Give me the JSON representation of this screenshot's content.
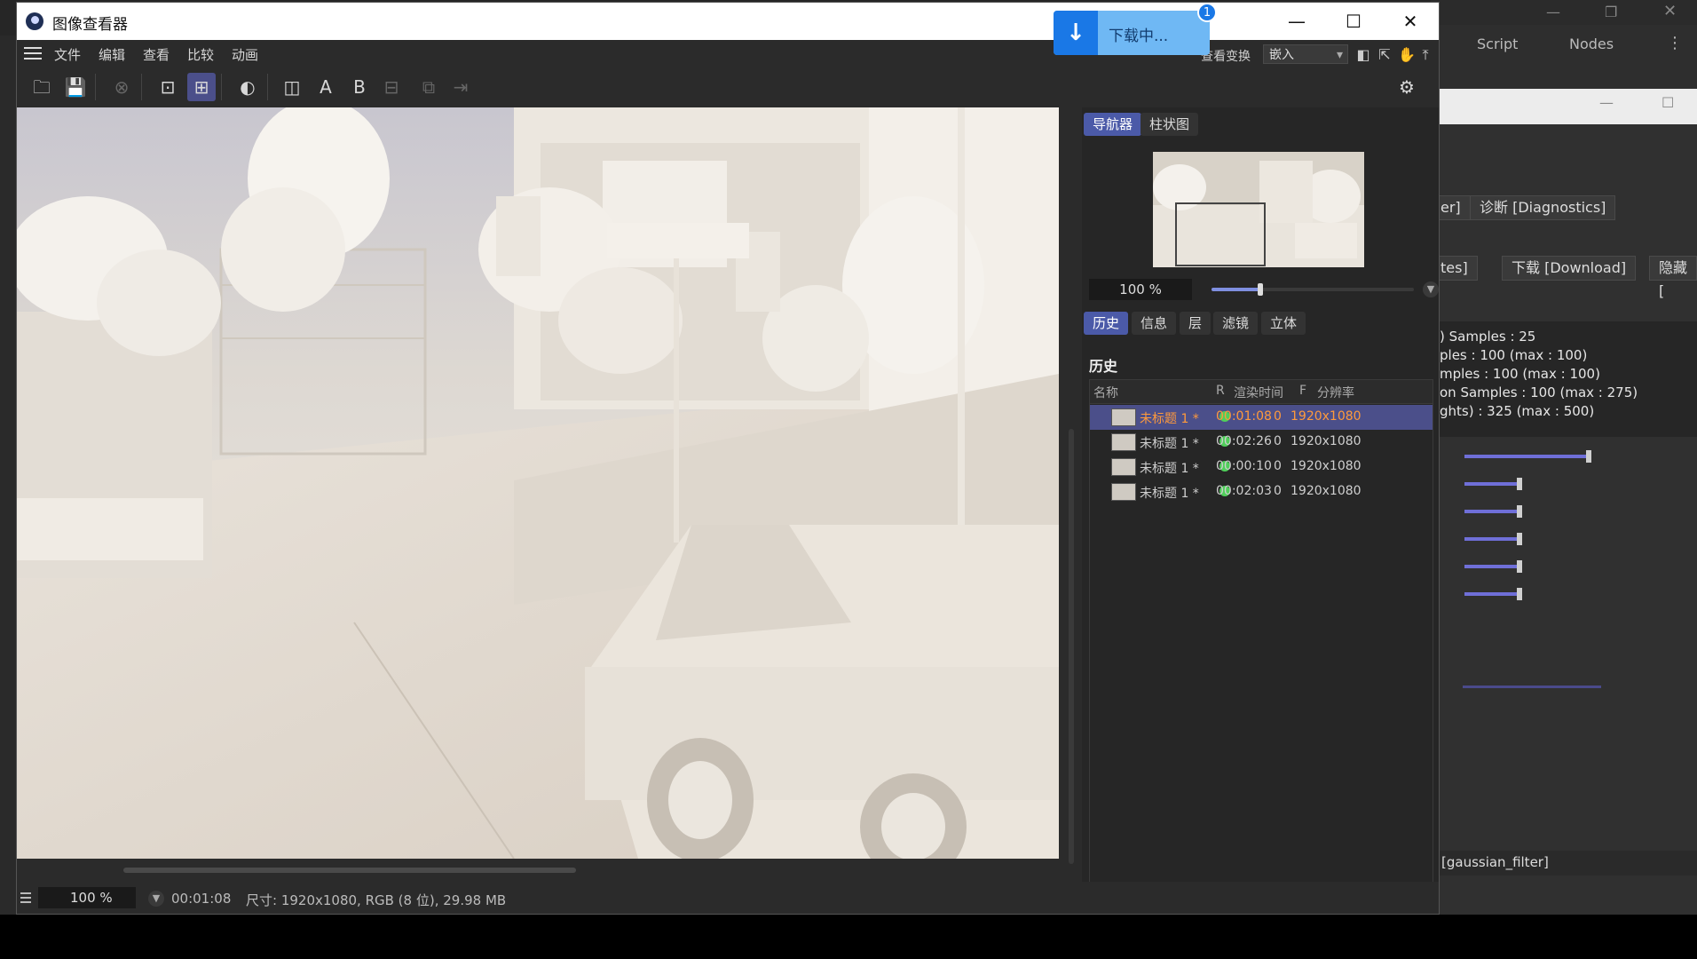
{
  "window": {
    "title": "图像查看器",
    "controls": {
      "minimize": "—",
      "maximize": "☐",
      "close": "✕"
    }
  },
  "download_popup": {
    "label": "下载中...",
    "badge": "1"
  },
  "menu": {
    "items": [
      "文件",
      "编辑",
      "查看",
      "比较",
      "动画"
    ],
    "view_transform_label": "查看变换",
    "view_transform_value": "嵌入"
  },
  "toolbar": {
    "a_label": "A",
    "b_label": "B"
  },
  "navigator": {
    "tabs": [
      "导航器",
      "柱状图"
    ],
    "zoom": "100 %",
    "zoom_slider_fraction": 0.24
  },
  "history": {
    "tabs": [
      "历史",
      "信息",
      "层",
      "滤镜",
      "立体"
    ],
    "title": "历史",
    "columns": {
      "name": "名称",
      "r": "R",
      "render_time": "渲染时间",
      "f": "F",
      "resolution": "分辨率"
    },
    "rows": [
      {
        "name": "未标题 1 *",
        "render_time": "00:01:08",
        "f": "0",
        "resolution": "1920x1080",
        "selected": true
      },
      {
        "name": "未标题 1 *",
        "render_time": "00:02:26",
        "f": "0",
        "resolution": "1920x1080",
        "selected": false
      },
      {
        "name": "未标题 1 *",
        "render_time": "00:00:10",
        "f": "0",
        "resolution": "1920x1080",
        "selected": false
      },
      {
        "name": "未标题 1 *",
        "render_time": "00:02:03",
        "f": "0",
        "resolution": "1920x1080",
        "selected": false
      }
    ]
  },
  "status": {
    "zoom": "100 %",
    "time": "00:01:08",
    "info": "尺寸: 1920x1080, RGB (8 位), 29.98 MB"
  },
  "background_app": {
    "tabs": [
      "Script",
      "Nodes"
    ],
    "buttons": [
      "er]",
      "诊断 [Diagnostics]",
      "tes]",
      "下载 [Download]",
      "隐藏 ["
    ],
    "lines": [
      ") Samples : 25",
      "ples : 100 (max : 100)",
      "mples : 100 (max : 100)",
      "on Samples : 100 (max : 275)",
      "ghts) : 325 (max : 500)"
    ],
    "filter_label": "[gaussian_filter]"
  }
}
